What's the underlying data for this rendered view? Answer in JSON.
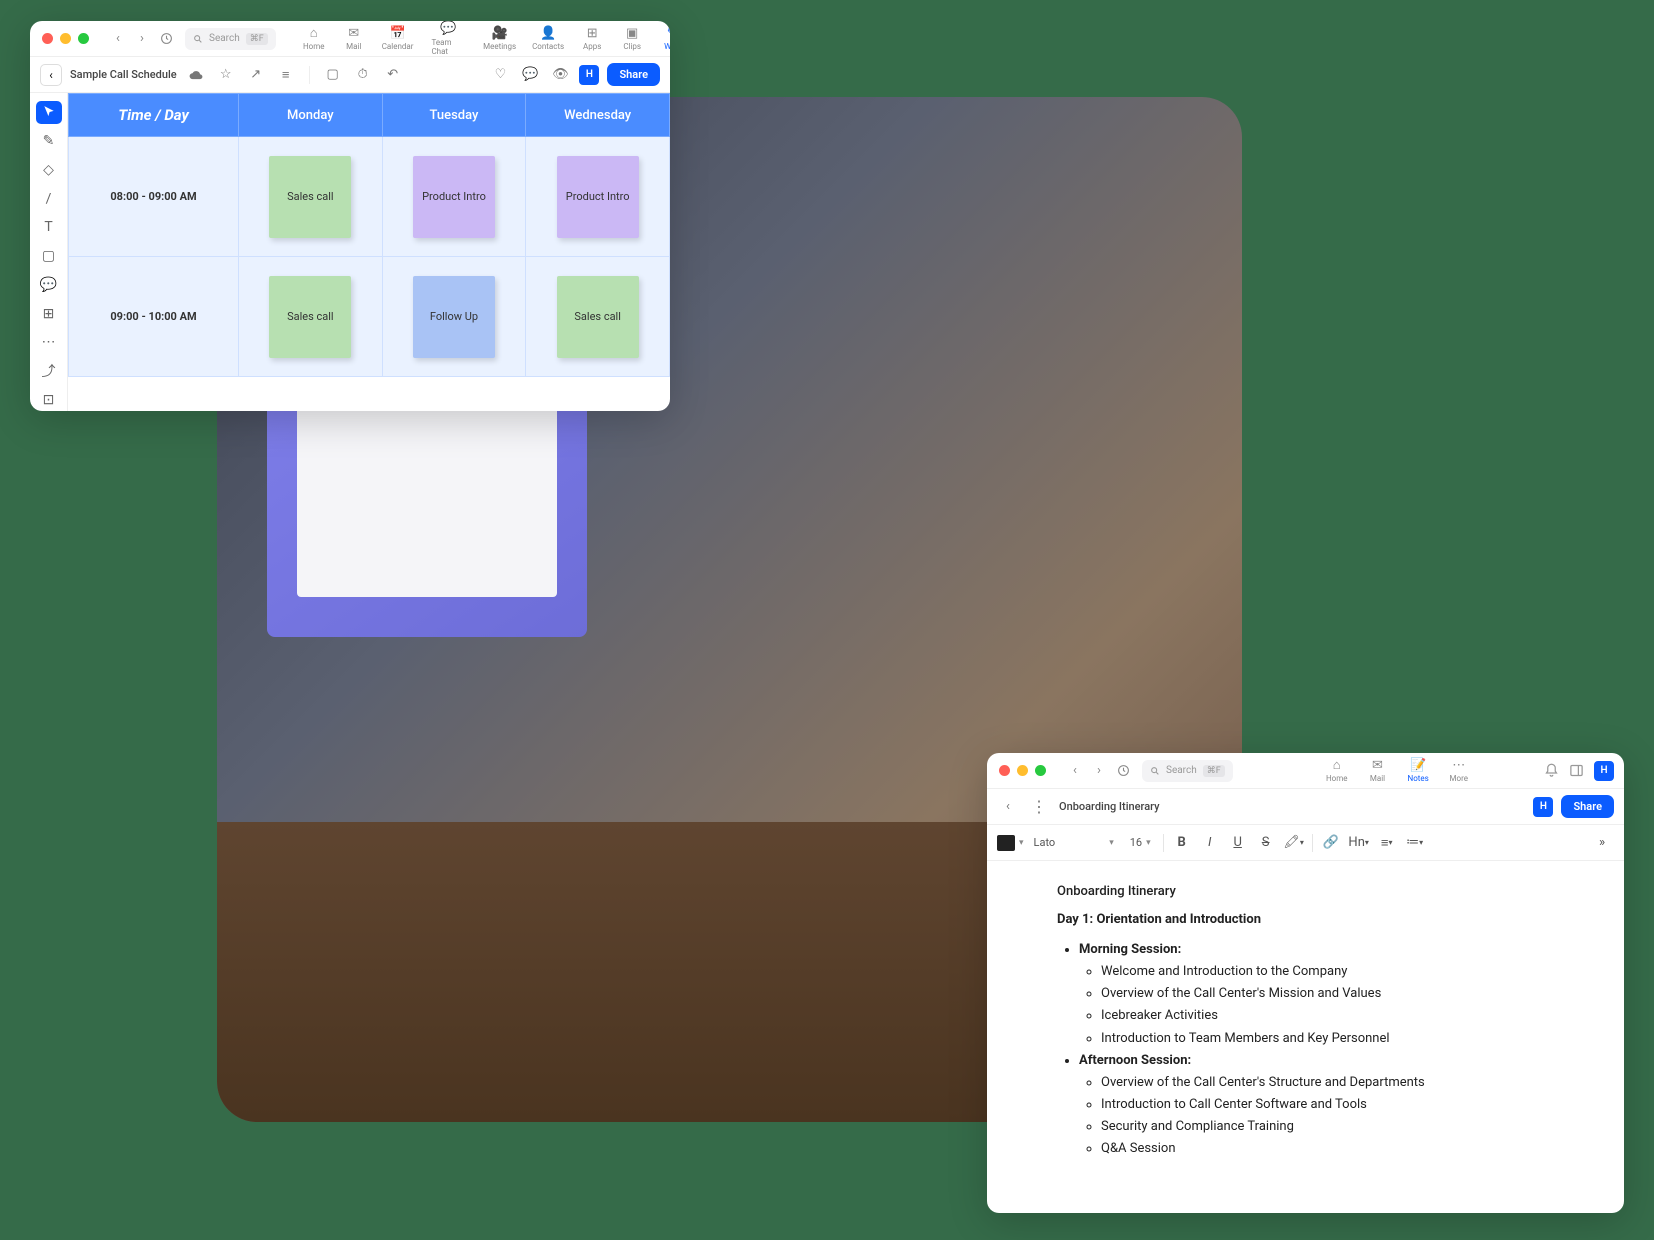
{
  "window1": {
    "search_placeholder": "Search",
    "search_kb": "⌘F",
    "tabs": [
      "Home",
      "Mail",
      "Calendar",
      "Team Chat",
      "Meetings",
      "Contacts",
      "Apps",
      "Clips",
      "Whit"
    ],
    "doc_title": "Sample Call Schedule",
    "share": "Share",
    "avatar": "H",
    "sched": {
      "header": "Time / Day",
      "days": [
        "Monday",
        "Tuesday",
        "Wednesday"
      ],
      "rows": [
        {
          "time": "08:00 - 09:00 AM",
          "cells": [
            {
              "t": "Sales call",
              "c": "green"
            },
            {
              "t": "Product Intro",
              "c": "purple"
            },
            {
              "t": "Product Intro",
              "c": "purple"
            }
          ]
        },
        {
          "time": "09:00 - 10:00 AM",
          "cells": [
            {
              "t": "Sales call",
              "c": "green"
            },
            {
              "t": "Follow Up",
              "c": "blue"
            },
            {
              "t": "Sales call",
              "c": "green"
            }
          ]
        }
      ]
    }
  },
  "window2": {
    "search_placeholder": "Search",
    "search_kb": "⌘F",
    "tabs": [
      "Home",
      "Mail",
      "Notes",
      "More"
    ],
    "active_tab": "Notes",
    "doc_title": "Onboarding Itinerary",
    "share": "Share",
    "avatar": "H",
    "font_name": "Lato",
    "font_size": "16",
    "content": {
      "h1": "Onboarding Itinerary",
      "h2": "Day 1: Orientation and Introduction",
      "s1_title": "Morning Session:",
      "s1_items": [
        "Welcome and Introduction to the Company",
        "Overview of the Call Center's Mission and Values",
        "Icebreaker Activities",
        "Introduction to Team Members and Key Personnel"
      ],
      "s2_title": "Afternoon Session:",
      "s2_items": [
        "Overview of the Call Center's Structure and Departments",
        "Introduction to Call Center Software and Tools",
        "Security and Compliance Training",
        "Q&A Session"
      ]
    }
  }
}
